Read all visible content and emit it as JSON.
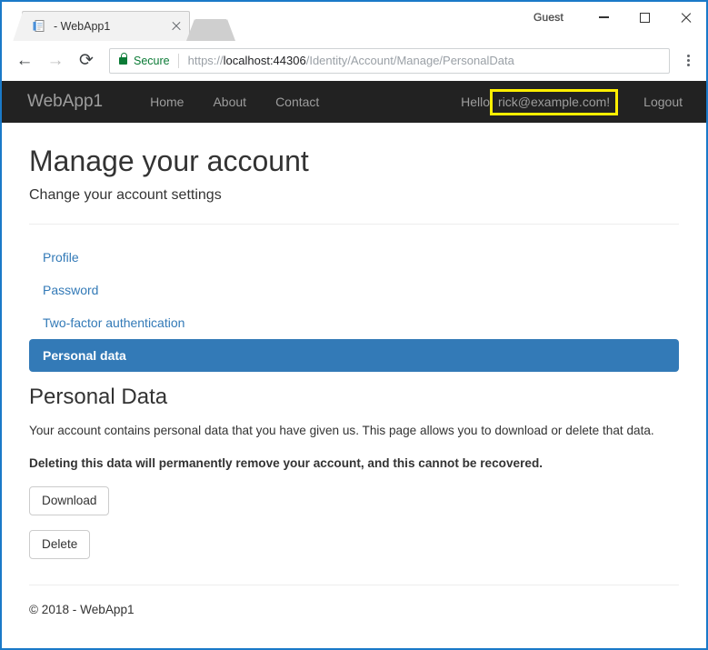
{
  "browser": {
    "tab": {
      "title": "- WebApp1",
      "favicon": "page-icon",
      "close": "×"
    },
    "window": {
      "profile_label": "Guest",
      "minimize": "minimize-icon",
      "maximize": "maximize-icon",
      "close": "close-icon"
    },
    "toolbar": {
      "back": "←",
      "forward": "→",
      "reload": "⟳",
      "menu": "menu-dots-icon"
    },
    "omnibox": {
      "security_label": "Secure",
      "lock": "lock-icon",
      "url_scheme": "https://",
      "url_host": "localhost:44306",
      "url_path": "/Identity/Account/Manage/PersonalData",
      "url_full": "https://localhost:44306/Identity/Account/Manage/PersonalData"
    }
  },
  "site": {
    "navbar": {
      "brand": "WebApp1",
      "links": [
        {
          "label": "Home"
        },
        {
          "label": "About"
        },
        {
          "label": "Contact"
        }
      ],
      "greeting_prefix": "Hello",
      "greeting_user": "rick@example.com!",
      "logout": "Logout",
      "highlight_color": "#ffef00",
      "background_color": "#222222"
    },
    "header": {
      "title": "Manage your account",
      "subtitle": "Change your account settings"
    },
    "manage_nav": [
      {
        "label": "Profile",
        "active": false
      },
      {
        "label": "Password",
        "active": false
      },
      {
        "label": "Two-factor authentication",
        "active": false
      },
      {
        "label": "Personal data",
        "active": true
      }
    ],
    "main": {
      "section_title": "Personal Data",
      "paragraph": "Your account contains personal data that you have given us. This page allows you to download or delete that data.",
      "warning": "Deleting this data will permanently remove your account, and this cannot be recovered.",
      "download_button": "Download",
      "delete_button": "Delete",
      "accent_color": "#337ab7",
      "link_color": "#337ab7"
    },
    "footer": {
      "copyright": "© 2018 - WebApp1"
    }
  }
}
